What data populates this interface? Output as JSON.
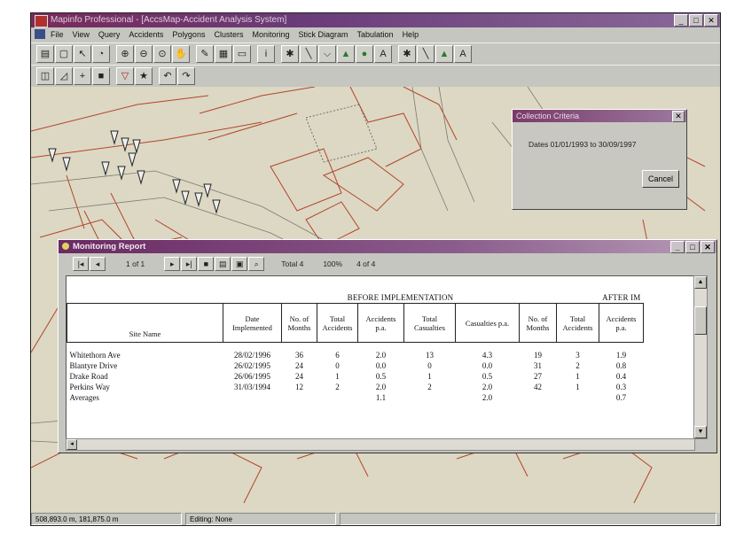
{
  "app": {
    "title": "Mapinfo Professional - [AccsMap-Accident Analysis System]",
    "menus": [
      "File",
      "View",
      "Query",
      "Accidents",
      "Polygons",
      "Clusters",
      "Monitoring",
      "Stick Diagram",
      "Tabulation",
      "Help"
    ]
  },
  "dialog": {
    "title": "Collection Criteria",
    "text": "Dates 01/01/1993 to 30/09/1997",
    "cancel_label": "Cancel"
  },
  "report": {
    "title": "Monitoring Report",
    "page": "1 of 1",
    "total": "Total 4",
    "zoom": "100%",
    "count": "4 of 4",
    "group_before": "BEFORE IMPLEMENTATION",
    "group_after": "AFTER IM",
    "headers": {
      "site": "Site Name",
      "date": "Date Implemented",
      "before_months": "No. of Months",
      "before_total_acc": "Total Accidents",
      "before_acc_pa": "Accidents p.a.",
      "before_total_cas": "Total Casualties",
      "before_cas_pa": "Casualties p.a.",
      "after_months": "No. of Months",
      "after_total_acc": "Total Accidents",
      "after_acc_pa": "Accidents p.a."
    },
    "rows": [
      {
        "site": "Whitethorn Ave",
        "date": "28/02/1996",
        "bm": "36",
        "bta": "6",
        "bap": "2.0",
        "btc": "13",
        "bcp": "4.3",
        "am": "19",
        "ata": "3",
        "aap": "1.9"
      },
      {
        "site": "Blantyre Drive",
        "date": "26/02/1995",
        "bm": "24",
        "bta": "0",
        "bap": "0.0",
        "btc": "0",
        "bcp": "0.0",
        "am": "31",
        "ata": "2",
        "aap": "0.8"
      },
      {
        "site": "Drake Road",
        "date": "26/06/1995",
        "bm": "24",
        "bta": "1",
        "bap": "0.5",
        "btc": "1",
        "bcp": "0.5",
        "am": "27",
        "ata": "1",
        "aap": "0.4"
      },
      {
        "site": "Perkins Way",
        "date": "31/03/1994",
        "bm": "12",
        "bta": "2",
        "bap": "2.0",
        "btc": "2",
        "bcp": "2.0",
        "am": "42",
        "ata": "1",
        "aap": "0.3"
      },
      {
        "site": "Averages",
        "date": "",
        "bm": "",
        "bta": "",
        "bap": "1.1",
        "btc": "",
        "bcp": "2.0",
        "am": "",
        "ata": "",
        "aap": "0.7"
      }
    ]
  },
  "status": {
    "coords": "508,893.0 m, 181,875.0 m",
    "editing": "Editing: None"
  }
}
